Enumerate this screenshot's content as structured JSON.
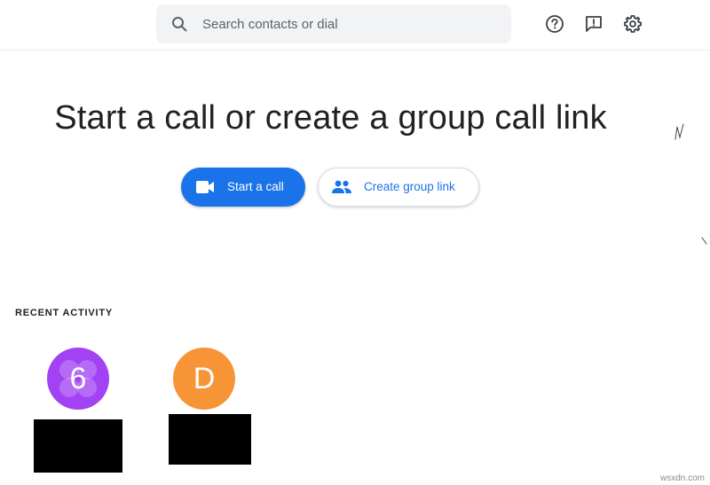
{
  "search": {
    "placeholder": "Search contacts or dial"
  },
  "header": {
    "help_icon": "help-circle-icon",
    "feedback_icon": "feedback-icon",
    "settings_icon": "gear-icon"
  },
  "hero": {
    "title": "Start a call or create a group call link"
  },
  "actions": {
    "start_call": {
      "label": "Start a call",
      "icon": "video-camera-icon"
    },
    "create_group_link": {
      "label": "Create group link",
      "icon": "people-icon"
    }
  },
  "recent": {
    "heading": "RECENT ACTIVITY",
    "items": [
      {
        "initial": "6",
        "color": "#a142f4"
      },
      {
        "initial": "D",
        "color": "#f79436"
      }
    ]
  },
  "watermark": "wsxdn.com",
  "colors": {
    "accent": "#1a73e8",
    "search_bg": "#f1f3f4",
    "text": "#202124"
  }
}
